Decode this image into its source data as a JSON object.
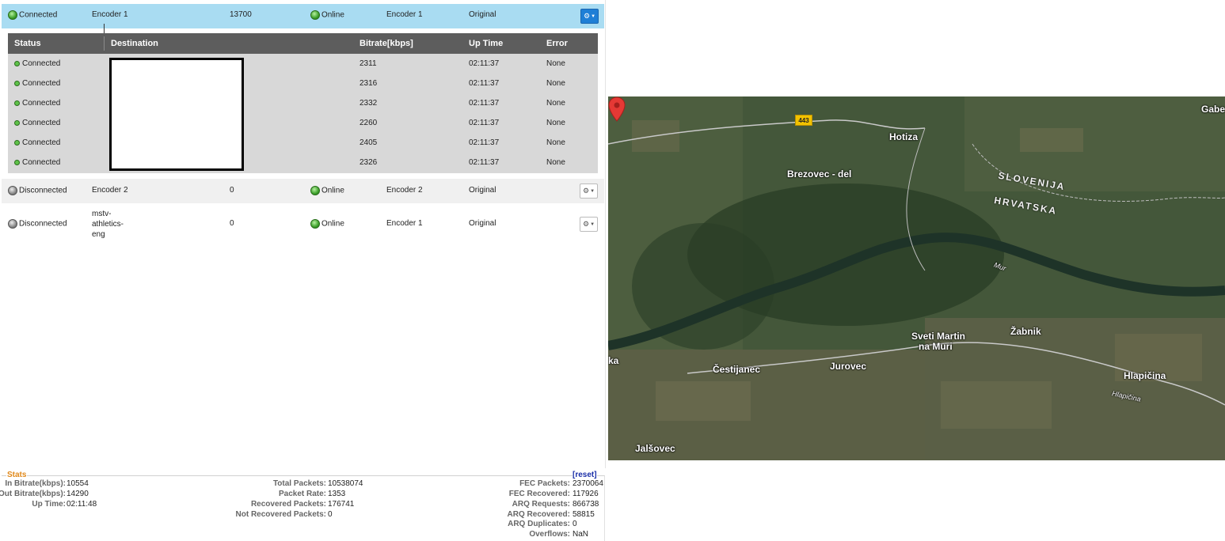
{
  "encoders": [
    {
      "status": "Connected",
      "name": "Encoder 1",
      "bitrate": "13700",
      "online": "Online",
      "source": "Encoder 1",
      "profile": "Original"
    },
    {
      "status": "Disconnected",
      "name": "Encoder 2",
      "bitrate": "0",
      "online": "Online",
      "source": "Encoder 2",
      "profile": "Original"
    },
    {
      "status": "Disconnected",
      "name_lines": [
        "mstv-",
        "athletics-",
        "eng"
      ],
      "bitrate": "0",
      "online": "Online",
      "source": "Encoder 1",
      "profile": "Original"
    }
  ],
  "destinations": {
    "headers": {
      "status": "Status",
      "destination": "Destination",
      "bitrate": "Bitrate[kbps]",
      "uptime": "Up Time",
      "error": "Error"
    },
    "rows": [
      {
        "status": "Connected",
        "bitrate": "2311",
        "uptime": "02:11:37",
        "error": "None"
      },
      {
        "status": "Connected",
        "bitrate": "2316",
        "uptime": "02:11:37",
        "error": "None"
      },
      {
        "status": "Connected",
        "bitrate": "2332",
        "uptime": "02:11:37",
        "error": "None"
      },
      {
        "status": "Connected",
        "bitrate": "2260",
        "uptime": "02:11:37",
        "error": "None"
      },
      {
        "status": "Connected",
        "bitrate": "2405",
        "uptime": "02:11:37",
        "error": "None"
      },
      {
        "status": "Connected",
        "bitrate": "2326",
        "uptime": "02:11:37",
        "error": "None"
      }
    ]
  },
  "stats": {
    "title": "Stats",
    "reset": "[reset]",
    "col1": [
      {
        "k": "In Bitrate(kbps):",
        "v": "10554"
      },
      {
        "k": "Out Bitrate(kbps):",
        "v": "14290"
      },
      {
        "k": "Up Time:",
        "v": "02:11:48"
      }
    ],
    "col2": [
      {
        "k": "Total Packets:",
        "v": "10538074"
      },
      {
        "k": "Packet Rate:",
        "v": "1353"
      },
      {
        "k": "Recovered Packets:",
        "v": "176741"
      },
      {
        "k": "Not Recovered Packets:",
        "v": "0"
      }
    ],
    "col3": [
      {
        "k": "FEC Packets:",
        "v": "2370064"
      },
      {
        "k": "FEC Recovered:",
        "v": "117926"
      },
      {
        "k": "ARQ Requests:",
        "v": "866738"
      },
      {
        "k": "ARQ Recovered:",
        "v": "58815"
      },
      {
        "k": "ARQ Duplicates:",
        "v": "0"
      },
      {
        "k": "Overflows:",
        "v": "NaN"
      }
    ]
  },
  "map": {
    "road_number": "443",
    "labels": {
      "gabe": "Gabe",
      "hotiza": "Hotiza",
      "brezovec": "Brezovec - del",
      "slovenija": "SLOVENIJA",
      "hrvatska": "HRVATSKA",
      "mur": "Mur",
      "sveti_martin_1": "Sveti Martin",
      "sveti_martin_2": "na Muri",
      "zabnik": "Žabnik",
      "cestijanec": "Čestijanec",
      "jurovec": "Jurovec",
      "ka": "ka",
      "hlapicina": "Hlapičina",
      "hlapicina_road": "Hlapičina",
      "jalsovec": "Jalšovec"
    },
    "colors": {
      "pin": "#e53935",
      "river": "#2d4a3a",
      "road": "#c9c9c9"
    }
  }
}
